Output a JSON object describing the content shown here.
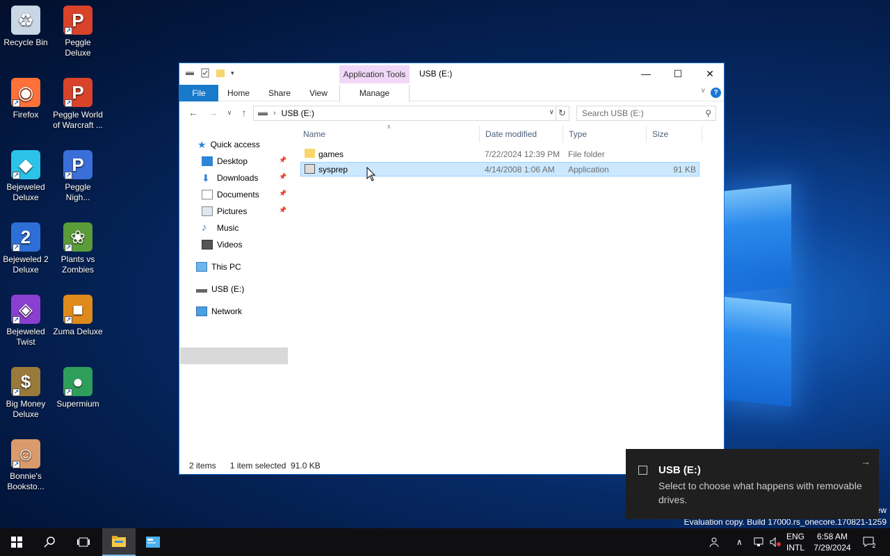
{
  "desktop": {
    "icons": [
      {
        "label": "Recycle Bin",
        "icon": "recycle-bin-icon",
        "color": "#c9d6e6"
      },
      {
        "label": "Peggle Deluxe",
        "icon": "peggle-icon",
        "color": "#d8432a"
      },
      {
        "label": "Firefox",
        "icon": "firefox-icon",
        "color": "#ff7139"
      },
      {
        "label": "Peggle World of Warcraft ...",
        "icon": "peggle-wow-icon",
        "color": "#d8432a"
      },
      {
        "label": "Bejeweled Deluxe",
        "icon": "bejeweled-icon",
        "color": "#2bc3e8"
      },
      {
        "label": "Peggle Nigh...",
        "icon": "peggle-nights-icon",
        "color": "#3a6fd8"
      },
      {
        "label": "Bejeweled 2 Deluxe",
        "icon": "bejeweled2-icon",
        "color": "#2d6fd6"
      },
      {
        "label": "Plants vs Zombies",
        "icon": "plants-vs-zombies-icon",
        "color": "#5a9b3a"
      },
      {
        "label": "Bejeweled Twist",
        "icon": "bejeweled-twist-icon",
        "color": "#8a3fd0"
      },
      {
        "label": "Zuma Deluxe",
        "icon": "zuma-icon",
        "color": "#e08a1c"
      },
      {
        "label": "Big Money Deluxe",
        "icon": "big-money-icon",
        "color": "#9a7a3a"
      },
      {
        "label": "Supermium",
        "icon": "supermium-icon",
        "color": "#2f9e5b"
      },
      {
        "label": "Bonnie's Booksto...",
        "icon": "bonnie-icon",
        "color": "#d99a6c"
      }
    ]
  },
  "explorer": {
    "title": "USB (E:)",
    "app_tools": "Application Tools",
    "tabs": {
      "file": "File",
      "home": "Home",
      "share": "Share",
      "view": "View",
      "manage": "Manage"
    },
    "address": {
      "path": "USB (E:)",
      "search_placeholder": "Search USB (E:)"
    },
    "nav": {
      "quick_access": "Quick access",
      "desktop": "Desktop",
      "downloads": "Downloads",
      "documents": "Documents",
      "pictures": "Pictures",
      "music": "Music",
      "videos": "Videos",
      "this_pc": "This PC",
      "usb": "USB (E:)",
      "network": "Network"
    },
    "columns": {
      "name": "Name",
      "date": "Date modified",
      "type": "Type",
      "size": "Size"
    },
    "files": [
      {
        "name": "games",
        "date": "7/22/2024 12:39 PM",
        "type": "File folder",
        "size": ""
      },
      {
        "name": "sysprep",
        "date": "4/14/2008 1:06 AM",
        "type": "Application",
        "size": "91 KB"
      }
    ],
    "status": {
      "items": "2 items",
      "selected": "1 item selected  91.0 KB"
    }
  },
  "toast": {
    "title": "USB (E:)",
    "body": "Select to choose what happens with removable drives."
  },
  "watermark": {
    "line1": "ew",
    "line2": "Evaluation copy. Build 17000.rs_onecore.170821-1259"
  },
  "taskbar": {
    "lang": "ENG",
    "layout": "INTL",
    "time": "6:58 AM",
    "date": "7/29/2024",
    "notifications": "2"
  }
}
